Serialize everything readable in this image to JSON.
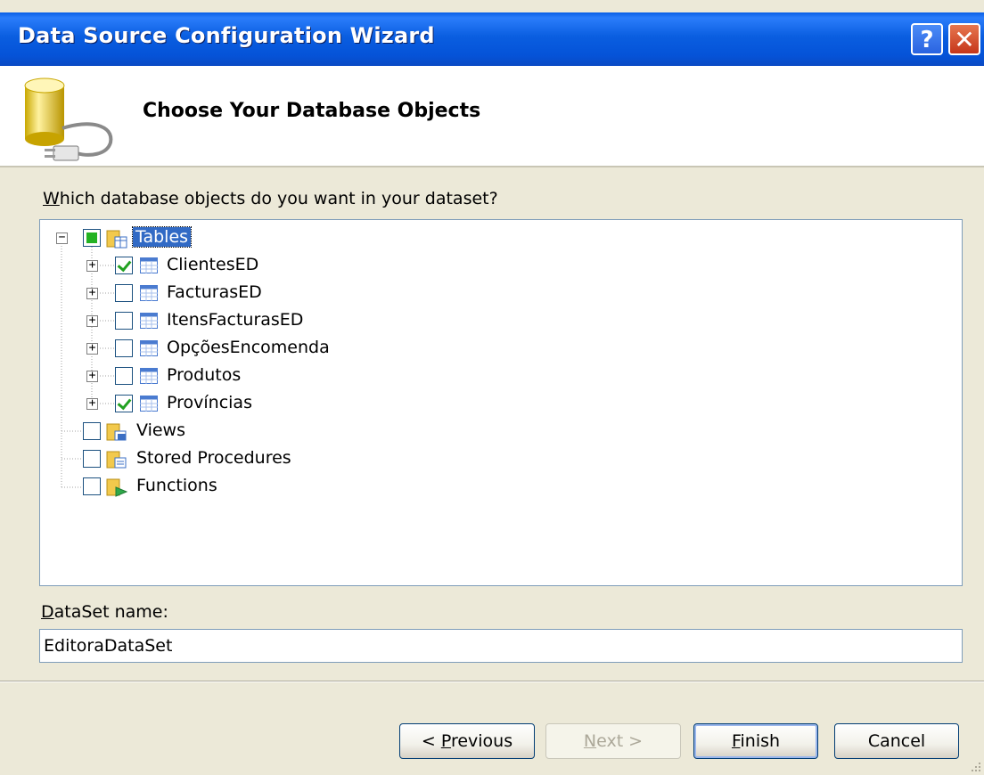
{
  "window": {
    "title": "Data Source Configuration Wizard",
    "help_glyph": "?",
    "close_glyph": "✕"
  },
  "header": {
    "title": "Choose Your Database Objects"
  },
  "prompt": {
    "prefix": "W",
    "rest": "hich database objects do you want in your dataset?"
  },
  "tree": {
    "tables": {
      "label": "Tables",
      "checkbox_state": "partial",
      "expanded": true,
      "items": [
        {
          "label": "ClientesED",
          "checked": true
        },
        {
          "label": "FacturasED",
          "checked": false
        },
        {
          "label": "ItensFacturasED",
          "checked": false
        },
        {
          "label": "OpçõesEncomenda",
          "checked": false
        },
        {
          "label": "Produtos",
          "checked": false
        },
        {
          "label": "Províncias",
          "checked": true
        }
      ]
    },
    "views": {
      "label": "Views",
      "checked": false
    },
    "stored_procedures": {
      "label": "Stored Procedures",
      "checked": false
    },
    "functions": {
      "label": "Functions",
      "checked": false
    }
  },
  "dataset": {
    "label_prefix": "D",
    "label_rest": "ataSet name:",
    "value": "EditoraDataSet"
  },
  "buttons": {
    "previous": {
      "pre": "< ",
      "key": "P",
      "post": "revious"
    },
    "next": {
      "key": "N",
      "post": "ext >"
    },
    "finish": {
      "key": "F",
      "post": "inish"
    },
    "cancel": "Cancel"
  },
  "colors": {
    "titlebar": "#0a5ee0",
    "selection": "#316ac5",
    "window_bg": "#ece9d8"
  }
}
